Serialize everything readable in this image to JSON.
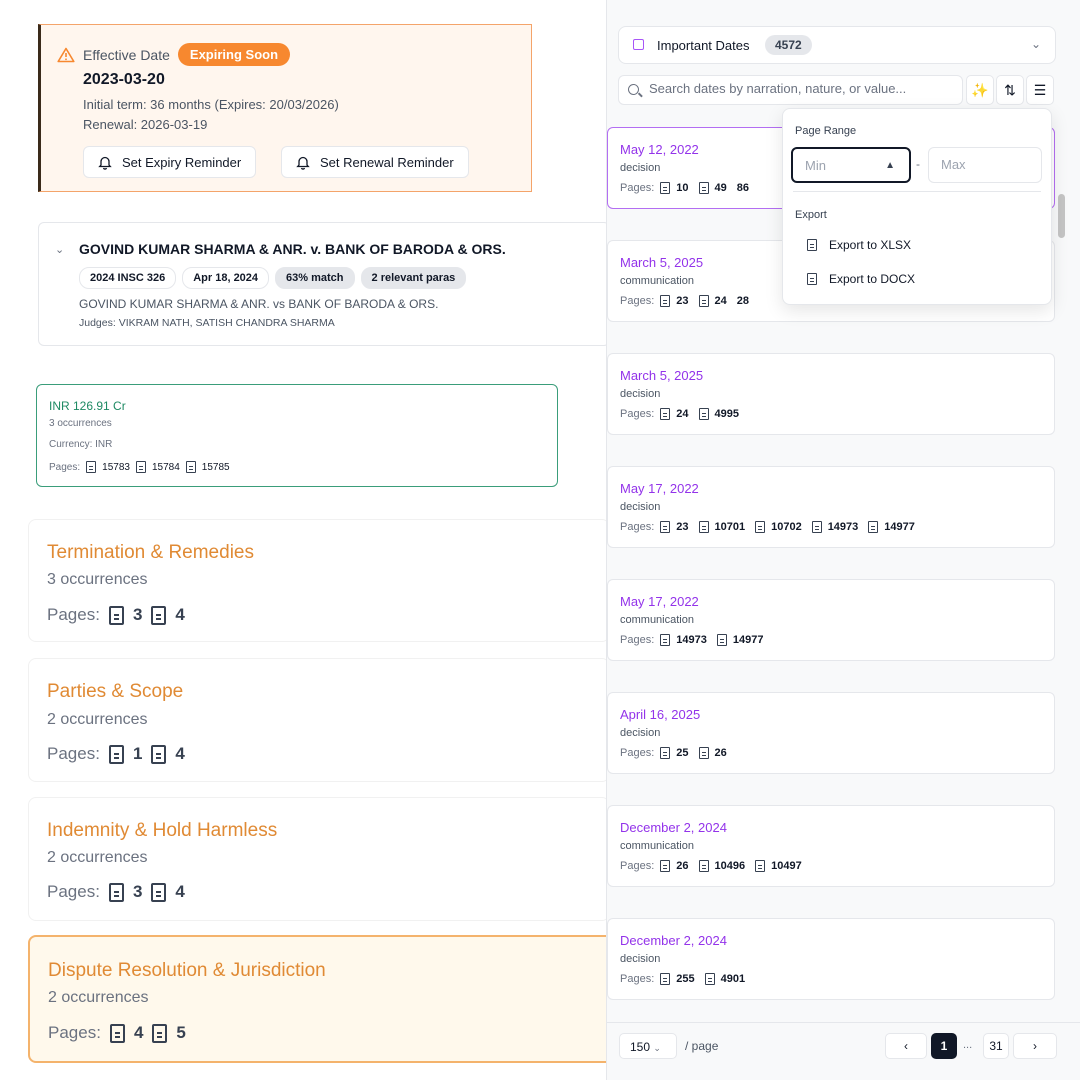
{
  "effective": {
    "label": "Effective Date",
    "badge": "Expiring Soon",
    "date": "2023-03-20",
    "term": "Initial term: 36 months (Expires: 20/03/2026)",
    "renewal": "Renewal: 2026-03-19",
    "expiry_btn": "Set Expiry Reminder",
    "renewal_btn": "Set Renewal Reminder"
  },
  "case": {
    "title": "GOVIND KUMAR SHARMA & ANR. v. BANK OF BARODA & ORS.",
    "chips": [
      "2024 INSC 326",
      "Apr 18, 2024",
      "63% match",
      "2 relevant paras"
    ],
    "parties": "GOVIND KUMAR SHARMA & ANR. vs BANK OF BARODA & ORS.",
    "judges": "Judges: VIKRAM NATH, SATISH CHANDRA SHARMA"
  },
  "amount": {
    "value": "INR 126.91 Cr",
    "occurrences": "3 occurrences",
    "currency": "Currency: INR",
    "pages_label": "Pages:",
    "pages": [
      "15783",
      "15784",
      "15785"
    ]
  },
  "topics": [
    {
      "title": "Termination & Remedies",
      "occ": "3 occurrences",
      "pages_label": "Pages:",
      "pages": [
        "3",
        "4"
      ]
    },
    {
      "title": "Parties & Scope",
      "occ": "2 occurrences",
      "pages_label": "Pages:",
      "pages": [
        "1",
        "4"
      ]
    },
    {
      "title": "Indemnity & Hold Harmless",
      "occ": "2 occurrences",
      "pages_label": "Pages:",
      "pages": [
        "3",
        "4"
      ]
    },
    {
      "title": "Dispute Resolution & Jurisdiction",
      "occ": "2 occurrences",
      "pages_label": "Pages:",
      "pages": [
        "4",
        "5"
      ]
    }
  ],
  "panel": {
    "title": "Important Dates",
    "count": "4572",
    "search_placeholder": "Search dates by narration, nature, or value...",
    "dates": [
      {
        "date": "May 12, 2022",
        "nature": "decision",
        "pages": [
          "10",
          "49",
          "86"
        ]
      },
      {
        "date": "March 5, 2025",
        "nature": "communication",
        "pages": [
          "23",
          "24",
          "28"
        ]
      },
      {
        "date": "March 5, 2025",
        "nature": "decision",
        "pages": [
          "24",
          "4995"
        ]
      },
      {
        "date": "May 17, 2022",
        "nature": "decision",
        "pages": [
          "23",
          "10701",
          "10702",
          "14973",
          "14977"
        ]
      },
      {
        "date": "May 17, 2022",
        "nature": "communication",
        "pages": [
          "14973",
          "14977"
        ]
      },
      {
        "date": "April 16, 2025",
        "nature": "decision",
        "pages": [
          "25",
          "26"
        ]
      },
      {
        "date": "December 2, 2024",
        "nature": "communication",
        "pages": [
          "26",
          "10496",
          "10497"
        ]
      },
      {
        "date": "December 2, 2024",
        "nature": "decision",
        "pages": [
          "255",
          "4901"
        ]
      }
    ],
    "pages_label": "Pages:"
  },
  "dropdown": {
    "page_range_label": "Page Range",
    "min_placeholder": "Min",
    "max_placeholder": "Max",
    "dash": "-",
    "export_label": "Export",
    "export_xlsx": "Export to XLSX",
    "export_docx": "Export to DOCX"
  },
  "pager": {
    "per_page": "150",
    "per_page_label": "/ page",
    "current": "1",
    "ellipsis": "...",
    "last": "31"
  }
}
